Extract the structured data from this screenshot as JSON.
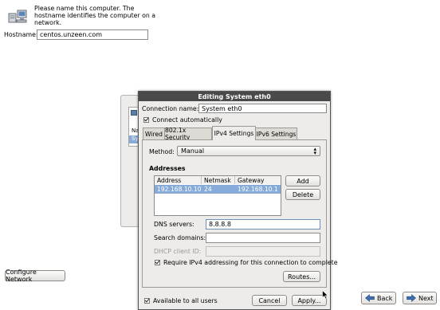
{
  "intro": {
    "text_line1": "Please name this computer.  The",
    "text_line2": "hostname identifies the computer on a",
    "text_line3": "network."
  },
  "hostname": {
    "label": "Hostname:",
    "value": "centos.unzeen.com"
  },
  "bg_list": {
    "col": "Na",
    "row": "Sy"
  },
  "configure_network_label": "Configure Network",
  "nav": {
    "back_label": "Back",
    "next_label": "Next"
  },
  "dialog": {
    "title": "Editing System eth0",
    "connection_name_label": "Connection name:",
    "connection_name_value": "System eth0",
    "connect_auto_label": "Connect automatically",
    "tabs": [
      "Wired",
      "802.1x Security",
      "IPv4 Settings",
      "IPv6 Settings"
    ],
    "method_label": "Method:",
    "method_value": "Manual",
    "addresses_heading": "Addresses",
    "table": {
      "headers": [
        "Address",
        "Netmask",
        "Gateway"
      ],
      "rows": [
        [
          "192.168.10.10",
          "24",
          "192.168.10.1"
        ]
      ]
    },
    "add_label": "Add",
    "delete_label": "Delete",
    "dns_label": "DNS servers:",
    "dns_value": "8.8.8.8",
    "search_domains_label": "Search domains:",
    "search_domains_value": "",
    "dhcp_client_id_label": "DHCP client ID:",
    "require_ipv4_label": "Require IPv4 addressing for this connection to complete",
    "routes_label": "Routes...",
    "available_all_users_label": "Available to all users",
    "cancel_label": "Cancel",
    "apply_label": "Apply..."
  },
  "colors": {
    "selection": "#86abd9",
    "title_bar": "#4a4a4a",
    "dialog_bg": "#edeceb"
  }
}
